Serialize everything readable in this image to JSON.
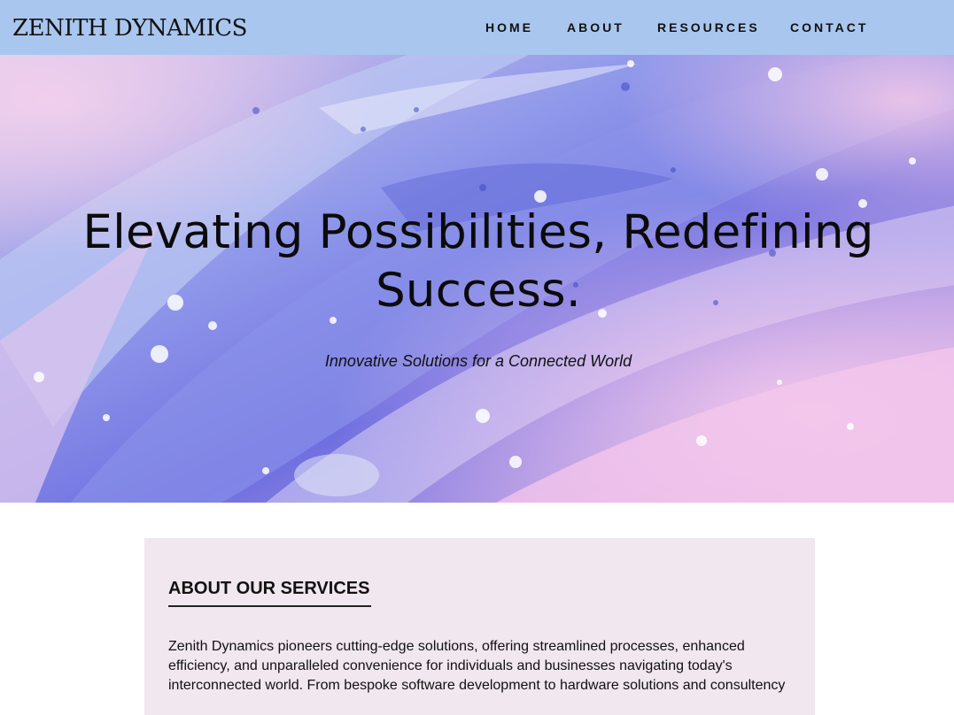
{
  "nav": {
    "brand": "ZENITH DYNAMICS",
    "items": [
      {
        "label": "HOME"
      },
      {
        "label": "ABOUT"
      },
      {
        "label": "RESOURCES"
      },
      {
        "label": "CONTACT"
      }
    ]
  },
  "hero": {
    "title_line1": "Elevating Possibilities, Redefining",
    "title_line2": "Success.",
    "subtitle": "Innovative Solutions for a Connected World"
  },
  "about": {
    "heading": "ABOUT OUR SERVICES",
    "body": "Zenith Dynamics pioneers cutting-edge solutions, offering streamlined processes, enhanced efficiency, and unparalleled convenience for individuals and businesses navigating today's interconnected world. From bespoke software development to hardware solutions and consultency"
  },
  "colors": {
    "nav_background": "#a9c6ef",
    "about_card_background": "#f1e7ef",
    "text": "#111111"
  }
}
